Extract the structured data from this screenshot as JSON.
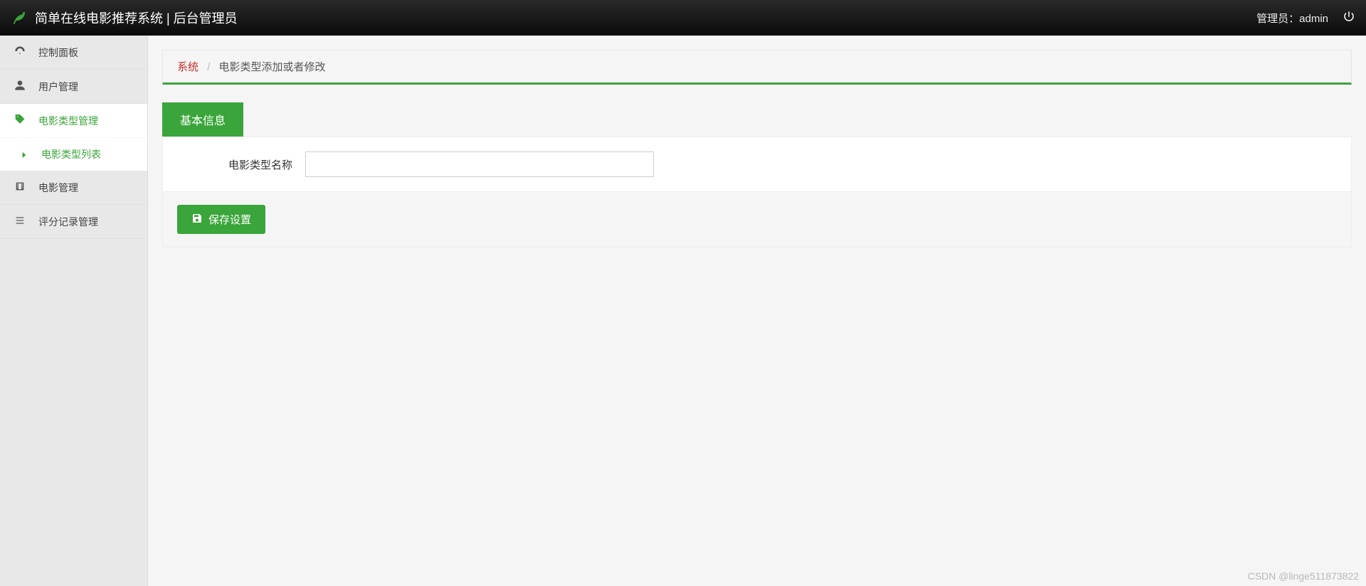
{
  "header": {
    "title": "简单在线电影推荐系统 | 后台管理员",
    "admin_label": "管理员：",
    "admin_name": "admin"
  },
  "sidebar": {
    "items": [
      {
        "label": "控制面板",
        "icon": "dashboard",
        "active": false
      },
      {
        "label": "用户管理",
        "icon": "user",
        "active": false
      },
      {
        "label": "电影类型管理",
        "icon": "tag",
        "active": true
      },
      {
        "label": "电影管理",
        "icon": "film",
        "active": false
      },
      {
        "label": "评分记录管理",
        "icon": "list",
        "active": false
      }
    ],
    "subitems": [
      {
        "label": "电影类型列表",
        "parent": 2
      }
    ]
  },
  "breadcrumb": {
    "root": "系统",
    "current": "电影类型添加或者修改"
  },
  "tabs": {
    "active_label": "基本信息"
  },
  "form": {
    "field_label": "电影类型名称",
    "field_value": ""
  },
  "actions": {
    "save_label": "保存设置"
  },
  "watermark": "CSDN @linge511873822"
}
